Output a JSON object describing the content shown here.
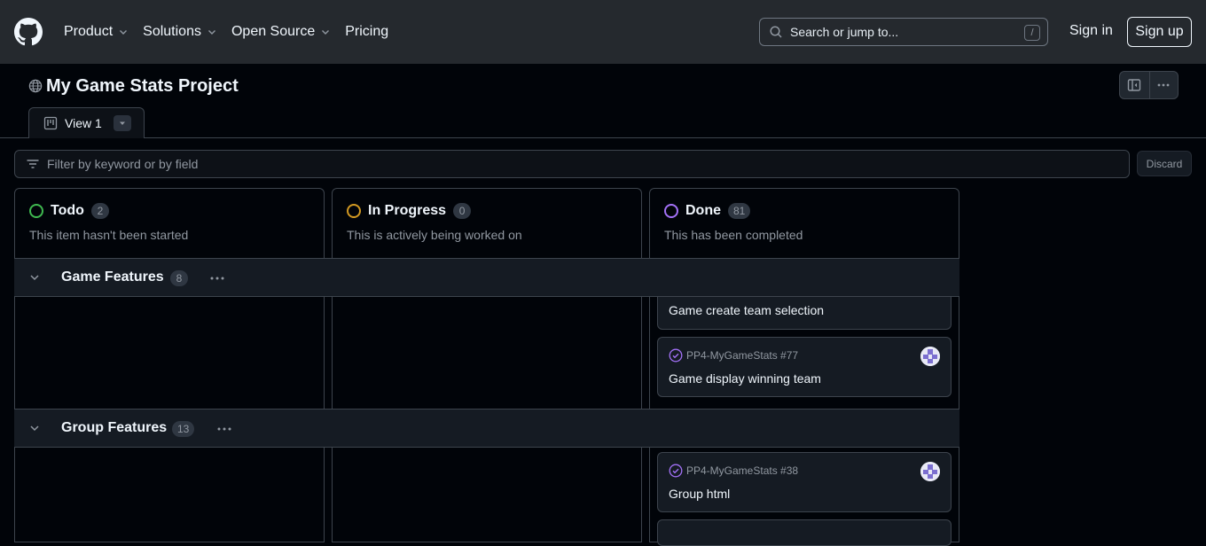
{
  "header": {
    "nav": [
      {
        "label": "Product",
        "has_menu": true
      },
      {
        "label": "Solutions",
        "has_menu": true
      },
      {
        "label": "Open Source",
        "has_menu": true
      },
      {
        "label": "Pricing",
        "has_menu": false
      }
    ],
    "search_placeholder": "Search or jump to...",
    "search_shortcut": "/",
    "sign_in": "Sign in",
    "sign_up": "Sign up"
  },
  "project": {
    "title": "My Game Stats Project",
    "view_tab": "View 1"
  },
  "filter": {
    "placeholder": "Filter by keyword or by field",
    "discard": "Discard"
  },
  "columns": [
    {
      "name": "Todo",
      "count": "2",
      "description": "This item hasn't been started",
      "color": "#3fb950"
    },
    {
      "name": "In Progress",
      "count": "0",
      "description": "This is actively being worked on",
      "color": "#d29922"
    },
    {
      "name": "Done",
      "count": "81",
      "description": "This has been completed",
      "color": "#a371f7"
    }
  ],
  "groups": [
    {
      "name": "Game Features",
      "count": "8",
      "cards": [
        {
          "ref": "",
          "title": "Game create team selection"
        },
        {
          "ref": "PP4-MyGameStats #77",
          "title": "Game display winning team"
        }
      ]
    },
    {
      "name": "Group Features",
      "count": "13",
      "cards": [
        {
          "ref": "PP4-MyGameStats #38",
          "title": "Group html"
        }
      ]
    }
  ]
}
